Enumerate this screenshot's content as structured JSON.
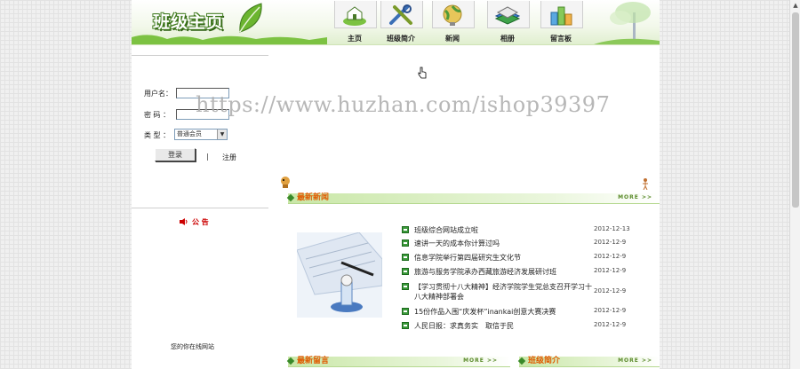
{
  "header": {
    "site_title": "班级主页",
    "nav": [
      {
        "label": "主页",
        "icon": "home-icon"
      },
      {
        "label": "班级简介",
        "icon": "tools-icon"
      },
      {
        "label": "新闻",
        "icon": "globe-icon"
      },
      {
        "label": "相册",
        "icon": "book-icon"
      },
      {
        "label": "留言板",
        "icon": "buildings-icon"
      }
    ]
  },
  "login": {
    "username_label": "用户名：",
    "password_label": "密  码 ：",
    "type_label": "类  型 ：",
    "type_value": "普通会员",
    "login_button": "登录",
    "separator": "|",
    "register_link": "注册"
  },
  "notice": {
    "title": "公  告"
  },
  "footer": {
    "text": "您的你在线网站"
  },
  "news": {
    "section_title": "最新新闻",
    "more": "MORE >>",
    "items": [
      {
        "title": "班级综合网站成立啦",
        "date": "2012-12-13"
      },
      {
        "title": "速讲一天的成本你计算过吗",
        "date": "2012-12-9"
      },
      {
        "title": "信息学院举行第四届研究生文化节",
        "date": "2012-12-9"
      },
      {
        "title": "旅游与服务学院承办西藏旅游经济发展研讨班",
        "date": "2012-12-9"
      },
      {
        "title": "【学习贯彻十八大精神】经济学院学生党总支召开学习十八大精神部署会",
        "date": "2012-12-9"
      },
      {
        "title": "15份作品入围“庆发杯”inankai创意大赛决赛",
        "date": "2012-12-9"
      },
      {
        "title": "人民日报：求真务实　取信于民",
        "date": "2012-12-9"
      }
    ]
  },
  "messages": {
    "section_title": "最新留言",
    "more": "MORE >>"
  },
  "class_intro": {
    "section_title": "班级简介",
    "more": "MORE >>"
  },
  "watermark": "https://www.huzhan.com/ishop39397",
  "colors": {
    "accent_green": "#3a8a2a",
    "section_title": "#e05a00",
    "notice_red": "#c00000"
  }
}
